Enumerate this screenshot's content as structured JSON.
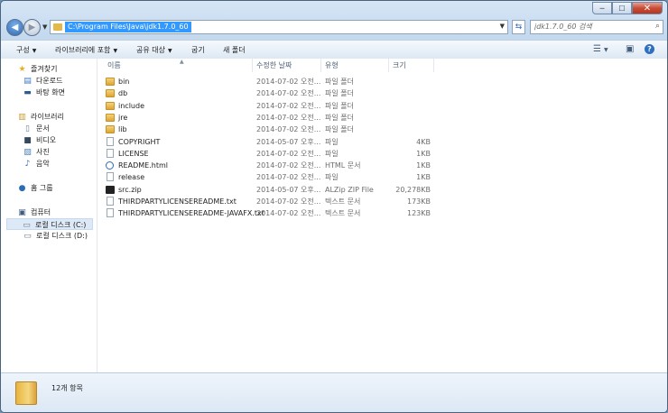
{
  "window": {
    "controls": {
      "minimize": "─",
      "maximize": "☐",
      "close": "✕"
    }
  },
  "address_bar": {
    "path": "C:\\Program Files\\Java\\jdk1.7.0_60",
    "search_placeholder": "jdk1.7.0_60 검색"
  },
  "toolbar": {
    "organize": "구성",
    "include_library": "라이브러리에 포함",
    "share_with": "공유 대상",
    "burn": "굽기",
    "new_folder": "새 폴더"
  },
  "nav": {
    "favorites": "즐겨찾기",
    "downloads": "다운로드",
    "desktop": "바탕 화면",
    "libraries": "라이브러리",
    "documents": "문서",
    "videos": "비디오",
    "pictures": "사진",
    "music": "음악",
    "homegroup": "홈 그룹",
    "computer": "컴퓨터",
    "local_c": "로컬 디스크 (C:)",
    "local_d": "로컬 디스크 (D:)"
  },
  "columns": {
    "name": "이름",
    "date": "수정한 날짜",
    "type": "유형",
    "size": "크기"
  },
  "files": [
    {
      "name": "bin",
      "date": "2014-07-02 오전...",
      "type": "파일 폴더",
      "size": "",
      "icon": "folder"
    },
    {
      "name": "db",
      "date": "2014-07-02 오전...",
      "type": "파일 폴더",
      "size": "",
      "icon": "folder"
    },
    {
      "name": "include",
      "date": "2014-07-02 오전...",
      "type": "파일 폴더",
      "size": "",
      "icon": "folder"
    },
    {
      "name": "jre",
      "date": "2014-07-02 오전...",
      "type": "파일 폴더",
      "size": "",
      "icon": "folder"
    },
    {
      "name": "lib",
      "date": "2014-07-02 오전...",
      "type": "파일 폴더",
      "size": "",
      "icon": "folder"
    },
    {
      "name": "COPYRIGHT",
      "date": "2014-05-07 오후...",
      "type": "파일",
      "size": "4KB",
      "icon": "file"
    },
    {
      "name": "LICENSE",
      "date": "2014-07-02 오전...",
      "type": "파일",
      "size": "1KB",
      "icon": "file"
    },
    {
      "name": "README.html",
      "date": "2014-07-02 오전...",
      "type": "HTML 문서",
      "size": "1KB",
      "icon": "html"
    },
    {
      "name": "release",
      "date": "2014-07-02 오전...",
      "type": "파일",
      "size": "1KB",
      "icon": "file"
    },
    {
      "name": "src.zip",
      "date": "2014-05-07 오후...",
      "type": "ALZip ZIP File",
      "size": "20,278KB",
      "icon": "zip"
    },
    {
      "name": "THIRDPARTYLICENSEREADME.txt",
      "date": "2014-07-02 오전...",
      "type": "텍스트 문서",
      "size": "173KB",
      "icon": "file"
    },
    {
      "name": "THIRDPARTYLICENSEREADME-JAVAFX.txt",
      "date": "2014-07-02 오전...",
      "type": "텍스트 문서",
      "size": "123KB",
      "icon": "file"
    }
  ],
  "status": {
    "item_count": "12개 항목"
  }
}
